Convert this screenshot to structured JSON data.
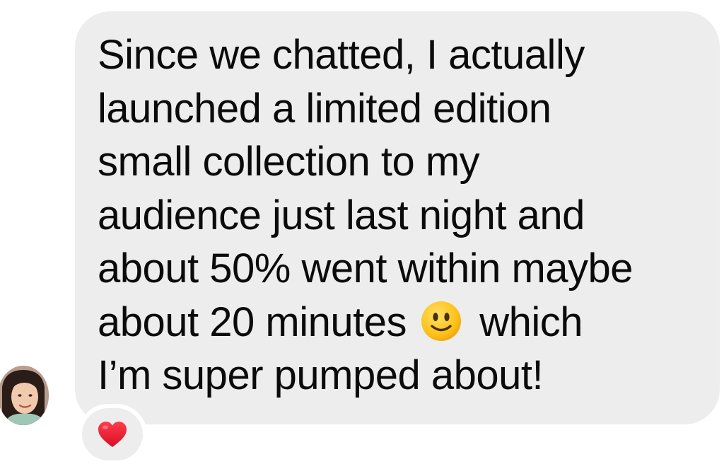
{
  "message": {
    "lines": [
      "Since we chatted, I actually",
      "launched a limited edition",
      "small collection to my",
      "audience just last night and",
      "about 50% went within maybe",
      "about 20 minutes",
      "which",
      "I’m super pumped about!"
    ],
    "inline_emoji": "slightly-smiling-face-icon",
    "bubble_color": "#ededed",
    "text_color": "#0b0b0b"
  },
  "sender": {
    "avatar": "avatar-photo"
  },
  "reaction": {
    "emoji": "red-heart-icon",
    "color": "#e8192c"
  }
}
